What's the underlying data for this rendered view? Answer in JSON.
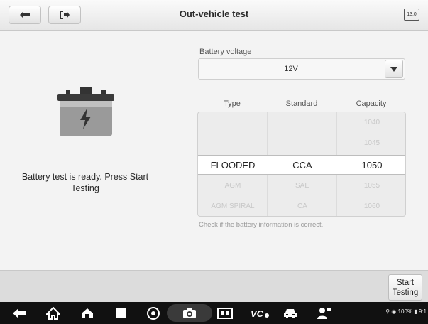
{
  "header": {
    "title": "Out-vehicle test",
    "back_icon": "arrow-left-icon",
    "exit_icon": "exit-icon",
    "vci_badge": "13.0"
  },
  "left_panel": {
    "battery_icon": "battery-icon",
    "status_text": "Battery test is ready. Press Start Testing"
  },
  "right_panel": {
    "voltage_label": "Battery voltage",
    "voltage_value": "12V",
    "columns": [
      "Type",
      "Standard",
      "Capacity"
    ],
    "rows": [
      [
        "",
        "",
        "1040"
      ],
      [
        "",
        "",
        "1045"
      ],
      [
        "FLOODED",
        "CCA",
        "1050"
      ],
      [
        "AGM",
        "SAE",
        "1055"
      ],
      [
        "AGM SPIRAL",
        "CA",
        "1060"
      ]
    ],
    "selected_row": 2,
    "hint": "Check if the battery information is correct."
  },
  "footer": {
    "start_button": "Start Testing"
  },
  "system_bar": {
    "status_text": "100% ▮ 9:1",
    "icons": [
      "back-icon",
      "home-outline-icon",
      "home-icon",
      "recent-apps-icon",
      "chrome-icon",
      "camera-icon",
      "screen-record-icon",
      "vci-icon",
      "car-icon",
      "mechanic-icon"
    ]
  },
  "colors": {
    "accent": "#2a2a2a",
    "panel_bg": "#f3f3f3",
    "system_bar": "#111111"
  }
}
